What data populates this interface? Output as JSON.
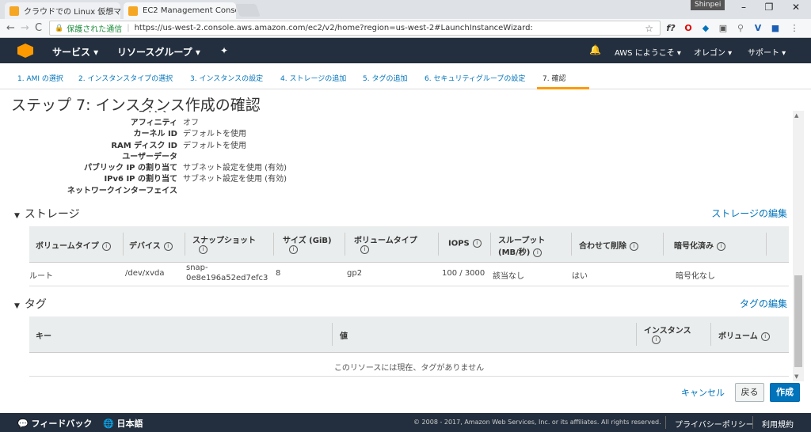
{
  "browser": {
    "tabs": [
      {
        "title": "クラウドでの Linux 仮想マシ"
      },
      {
        "title": "EC2 Management Conso"
      }
    ],
    "profile": "Shinpei",
    "nav": {
      "back": "←",
      "forward": "→",
      "reload": "C"
    },
    "secure_label": "保護された通信",
    "url": "https://us-west-2.console.aws.amazon.com/ec2/v2/home?region=us-west-2#LaunchInstanceWizard:"
  },
  "aws_header": {
    "services": "サービス ▾",
    "resource_groups": "リソースグループ ▾",
    "pin": "✦",
    "bell": "🔔",
    "welcome": "AWS にようこそ ▾",
    "region": "オレゴン ▾",
    "support": "サポート ▾"
  },
  "steps": [
    {
      "label": "1. AMI の選択"
    },
    {
      "label": "2. インスタンスタイプの選択"
    },
    {
      "label": "3. インスタンスの設定"
    },
    {
      "label": "4. ストレージの追加"
    },
    {
      "label": "5. タグの追加"
    },
    {
      "label": "6. セキュリティグループの設定"
    },
    {
      "label": "7. 確認"
    }
  ],
  "page_title": "ステップ 7: インスタンス作成の確認",
  "instance_details": [
    {
      "label": "アフィニティ",
      "value": "オフ"
    },
    {
      "label": "カーネル ID",
      "value": "デフォルトを使用"
    },
    {
      "label": "RAM ディスク ID",
      "value": "デフォルトを使用"
    },
    {
      "label": "ユーザーデータ",
      "value": ""
    },
    {
      "label": "パブリック IP の割り当て",
      "value": "サブネット設定を使用 (有効)"
    },
    {
      "label": "IPv6 IP の割り当て",
      "value": "サブネット設定を使用 (有効)"
    },
    {
      "label": "ネットワークインターフェイス",
      "value": ""
    }
  ],
  "storage": {
    "heading": "ストレージ",
    "edit_link": "ストレージの編集",
    "columns": [
      "ボリュームタイプ",
      "デバイス",
      "スナップショット",
      "サイズ (GiB)",
      "ボリュームタイプ",
      "IOPS",
      "スループット",
      "(MB/秒)",
      "合わせて削除",
      "暗号化済み"
    ],
    "row": {
      "volume_type": "ルート",
      "device": "/dev/xvda",
      "snapshot_line1": "snap-",
      "snapshot_line2": "0e8e196a52ed7efc3",
      "size": "8",
      "type": "gp2",
      "iops": "100 / 3000",
      "throughput": "該当なし",
      "delete_on_termination": "はい",
      "encrypted": "暗号化なし"
    }
  },
  "tags": {
    "heading": "タグ",
    "edit_link": "タグの編集",
    "columns": [
      "キー",
      "値",
      "インスタンス",
      "ボリューム"
    ],
    "empty_message": "このリソースには現在、タグがありません"
  },
  "actions": {
    "cancel": "キャンセル",
    "back": "戻る",
    "create": "作成"
  },
  "footer": {
    "feedback": "フィードバック",
    "language": "日本語",
    "copyright": "© 2008 - 2017, Amazon Web Services, Inc. or its affiliates. All rights reserved.",
    "privacy": "プライバシーポリシー",
    "terms": "利用規約"
  },
  "colors": {
    "aws_nav": "#232f3e",
    "link": "#0073bb",
    "accent": "#ff9900",
    "primary_button": "#0073bb"
  }
}
